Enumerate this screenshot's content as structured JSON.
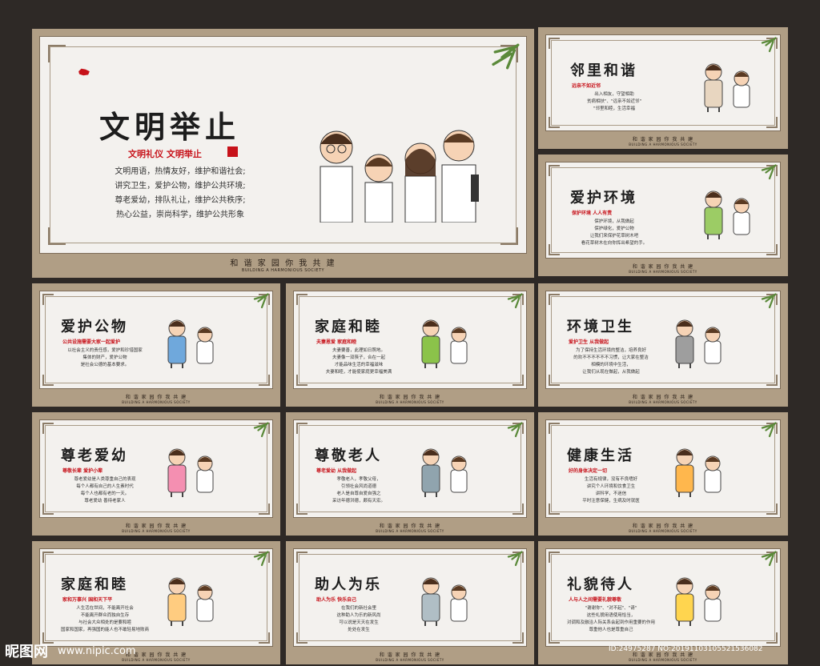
{
  "main": {
    "title": "文明举止",
    "subtitle": "文明礼仪 文明举止",
    "body": [
      "文明用语，热情友好，维护和谐社会;",
      "讲究卫生，爱护公物，维护公共环境;",
      "尊老爱幼，排队礼让，维护公共秩序;",
      "热心公益，崇尚科学，维护公共形象"
    ],
    "footer": "和 谐 家 园 你 我 共 建",
    "footer_en": "BUILDING A HARMONIOUS SOCIETY"
  },
  "panels": [
    {
      "title": "邻里和谐",
      "subtitle": "远亲不如近邻",
      "body": [
        "出入相友，守望相助",
        "贫病相扶\"、\"远亲不如近邻\"",
        "\"邻里和睦，生活幸福"
      ]
    },
    {
      "title": "爱护环境",
      "subtitle": "保护环境  人人有责",
      "body": [
        "保护环境，从我做起",
        "保护绿化，爱护公物",
        "让我们来保护花草树木吧",
        "看花草树木在向你挥出希望的手。"
      ]
    },
    {
      "title": "爱护公物",
      "subtitle": "公共设施需要大家一起爱护",
      "body": [
        "以社会主义的责任感，爱护和珍惜国家",
        "集体的财产，爱护公物",
        "是社会公德的基本要求。"
      ]
    },
    {
      "title": "家庭和睦",
      "subtitle": "夫妻恩爱  家庭和睦",
      "body": [
        "夫妻要善，此理如日照地。",
        "夫妻像一双筷子，合在一起",
        "才能品味生活的幸福滋味",
        "夫妻和睦，才能使家庭更幸福美满"
      ]
    },
    {
      "title": "环境卫生",
      "subtitle": "爱护卫生  从我做起",
      "body": [
        "为了保持生活环境的整洁，培养良好",
        "的欢不不不不不不习惯，让大家在整洁",
        "相模的环境中生活，",
        "让我们从现在做起，从我做起"
      ]
    },
    {
      "title": "尊老爱幼",
      "subtitle": "尊敬长辈  爱护小辈",
      "body": [
        "尊老爱幼是人类尊重自己的表现",
        "每个人都有自己的人生素时代",
        "每个人也都有老的一天。",
        "尊老爱幼 善待老家人"
      ]
    },
    {
      "title": "尊敬老人",
      "subtitle": "尊老爱幼  从我做起",
      "body": [
        "孝敬老人，孝敬父母，",
        "引领社会风尚道德",
        "老人是自尊自爱自强之",
        "采访年德洪德，颇有天宏。"
      ]
    },
    {
      "title": "健康生活",
      "subtitle": "好的身体决定一切",
      "body": [
        "生活有规律，没有不良嗜好",
        "讲究个人环境和饮食卫生",
        "讲科学，不迷信",
        "平时注意保健，生病及时就医"
      ]
    },
    {
      "title": "家庭和睦",
      "subtitle": "家和万事兴  国和天下平",
      "body": [
        "人生活在世间，不能离开社会",
        "不能离开群众而独自生存",
        "与社会大众相处的是要和睦",
        "国家和国家，再强国的能人也不敢轻易地败商"
      ]
    },
    {
      "title": "助人为乐",
      "subtitle": "助人为乐  快乐自己",
      "body": [
        "在我们的新社会里",
        "这种助人为乐的新风尚",
        "可以说是天天在发生",
        "处处在发生"
      ]
    },
    {
      "title": "礼貌待人",
      "subtitle": "人与人之间需要礼貌尊敬",
      "body": [
        "\"谢谢你\"、\"对不起\"、\"请\"",
        "这些礼貌用语使用恰当，",
        "对调和及融洽人际关系会起到作用重要的作用",
        "尊重他人也是尊重自己"
      ]
    }
  ],
  "panel_footer": "和 谐 家 园 你 我 共 建",
  "panel_footer_en": "BUILDING A HARMONIOUS SOCIETY",
  "watermark": {
    "logo": "昵图网",
    "url": "www.nipic.com",
    "id": "ID:24975287 NO:20191103105521536082"
  }
}
